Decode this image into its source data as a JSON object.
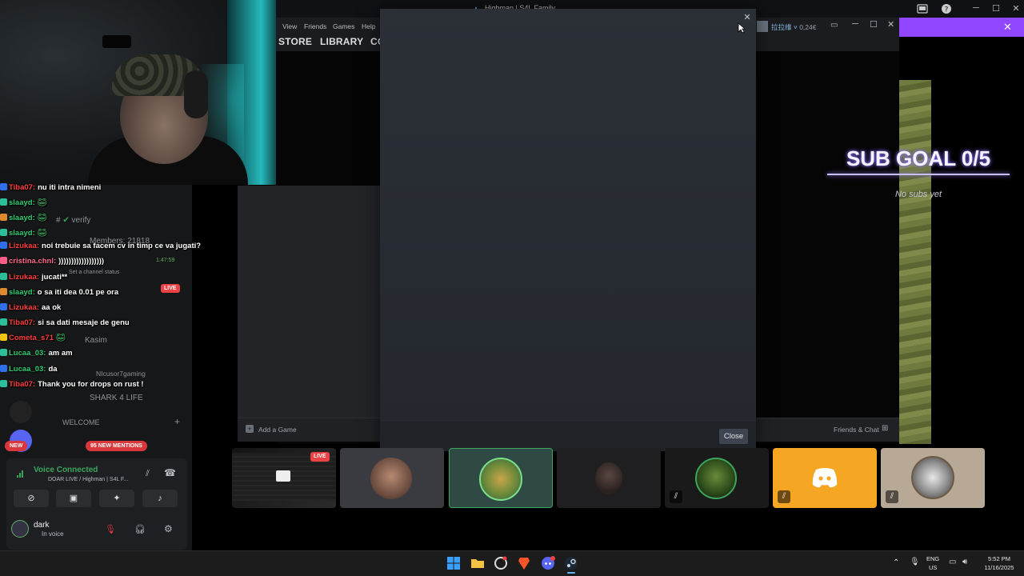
{
  "topbar": {
    "title": "Highman | S4L Family",
    "controls": {
      "minimize": "─",
      "maximize": "☐",
      "close": "✕"
    }
  },
  "chat": {
    "rows": [
      {
        "name": "Tiba07:",
        "message": "nu iti intra nimeni",
        "name_color": "#ff3b3b"
      },
      {
        "name": "slaayd:",
        "message": "",
        "name_color": "#2ecc71"
      },
      {
        "name": "slaayd:",
        "message": "",
        "name_color": "#2ecc71"
      },
      {
        "name": "slaayd:",
        "message": "",
        "name_color": "#2ecc71"
      },
      {
        "name": "Lizukaa:",
        "message": "noi trebuie sa facem cv in timp ce va jugati?",
        "name_color": "#ff3b3b"
      },
      {
        "name": "cristina.chnl:",
        "message": "))))))))))))))))))",
        "name_color": "#ff6b8a"
      },
      {
        "name": "Lizukaa:",
        "message": "jucati**",
        "name_color": "#ff3b3b"
      },
      {
        "name": "slaayd:",
        "message": "o sa iti dea 0.01 pe ora",
        "name_color": "#2ecc71"
      },
      {
        "name": "Lizukaa:",
        "message": "aa ok",
        "name_color": "#ff3b3b"
      },
      {
        "name": "Tiba07:",
        "message": "si sa dati mesaje de genu",
        "name_color": "#ff3b3b"
      },
      {
        "name": "Cometa_s71",
        "message": "",
        "name_color": "#ff3b3b"
      },
      {
        "name": "Lucaa_03:",
        "message": "am am",
        "name_color": "#2ecc71"
      },
      {
        "name": "Lucaa_03:",
        "message": "da",
        "name_color": "#2ecc71"
      },
      {
        "name": "Tiba07:",
        "message": "Thank you for drops on rust !",
        "name_color": "#ff3b3b"
      }
    ]
  },
  "discord": {
    "channel_verify": "verify",
    "members": "Members: 21818",
    "channel_status": "Set a channel status",
    "live_badge": "LIVE",
    "users": [
      "Kasim",
      "NIcusor7gaming"
    ],
    "channel_shark": "SHARK 4 LIFE",
    "welcome_category": "WELCOME",
    "new_badge": "NEW",
    "mentions": "95 NEW MENTIONS",
    "voice_connected": "Voice Connected",
    "voice_channel": "DOAR LIVE / Highman | S4L F...",
    "user_name": "dark",
    "user_status": "In voice",
    "timestamp": "1:47:59"
  },
  "steam": {
    "menu": [
      "View",
      "Friends",
      "Games",
      "Help"
    ],
    "nav": [
      "STORE",
      "LIBRARY",
      "CO"
    ],
    "account_name": "拉拉维",
    "wallet": "0,24€",
    "add_game": "Add a Game",
    "friends_chat": "Friends & Chat"
  },
  "modal": {
    "close_label": "Close",
    "close_x": "✕"
  },
  "overlay": {
    "sub_goal": "SUB GOAL 0/5",
    "no_subs": "No subs yet"
  },
  "tiles": {
    "live_label": "LIVE"
  },
  "taskbar": {
    "lang": "ENG",
    "region": "US",
    "time": "5:52 PM",
    "date": "11/16/2025"
  },
  "colors": {
    "discord_accent": "#5865f2",
    "twitch_purple": "#9146ff",
    "live_red": "#ed4245",
    "voice_green": "#3ba55c",
    "discord_tile_yellow": "#f5a623"
  }
}
